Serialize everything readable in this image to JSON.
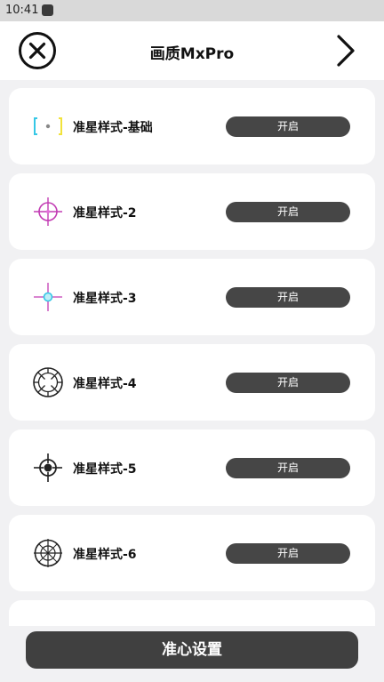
{
  "status_bar": {
    "time": "10:41"
  },
  "header": {
    "title": "画质MxPro"
  },
  "icons": {
    "close": "close-icon",
    "next": "chevron-right-icon"
  },
  "crosshairs": [
    {
      "label": "准星样式-基础",
      "button": "开启",
      "icon": "crosshair-basic-icon"
    },
    {
      "label": "准星样式-2",
      "button": "开启",
      "icon": "crosshair-style-2-icon"
    },
    {
      "label": "准星样式-3",
      "button": "开启",
      "icon": "crosshair-style-3-icon"
    },
    {
      "label": "准星样式-4",
      "button": "开启",
      "icon": "crosshair-style-4-icon"
    },
    {
      "label": "准星样式-5",
      "button": "开启",
      "icon": "crosshair-style-5-icon"
    },
    {
      "label": "准星样式-6",
      "button": "开启",
      "icon": "crosshair-style-6-icon"
    }
  ],
  "footer": {
    "button": "准心设置"
  },
  "colors": {
    "background": "#f1f1f3",
    "card": "#ffffff",
    "button": "#464646",
    "crosshair_pink": "#c23bb3",
    "crosshair_cyan": "#35c7e6",
    "crosshair_yellow": "#f1e23a"
  }
}
